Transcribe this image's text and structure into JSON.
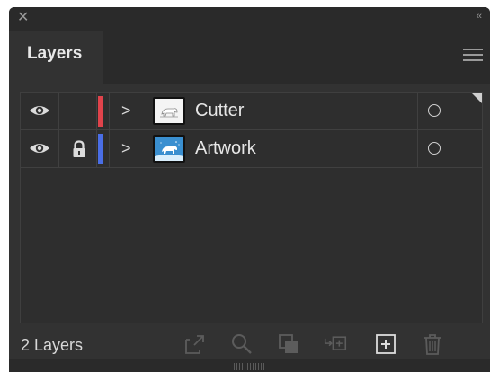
{
  "window": {
    "close_icon": "close-icon",
    "collapse_glyph": "‹‹"
  },
  "tabs": [
    {
      "label": "Layers",
      "active": true
    }
  ],
  "layers": [
    {
      "name": "Cutter",
      "visible": true,
      "locked": false,
      "color": "#e0434b",
      "thumbnail": "polar-bear-white-bg"
    },
    {
      "name": "Artwork",
      "visible": true,
      "locked": true,
      "color": "#4a6ee6",
      "thumbnail": "polar-bear-blue-bg"
    }
  ],
  "footer": {
    "layer_count": "2 Layers",
    "icons": [
      "export-icon",
      "search-icon",
      "clip-mask-icon",
      "sublayer-icon",
      "new-layer-icon",
      "trash-icon"
    ]
  },
  "colors": {
    "panel_bg": "#323232",
    "titlebar_bg": "#2a2a2a",
    "text": "#e6e6e6"
  }
}
